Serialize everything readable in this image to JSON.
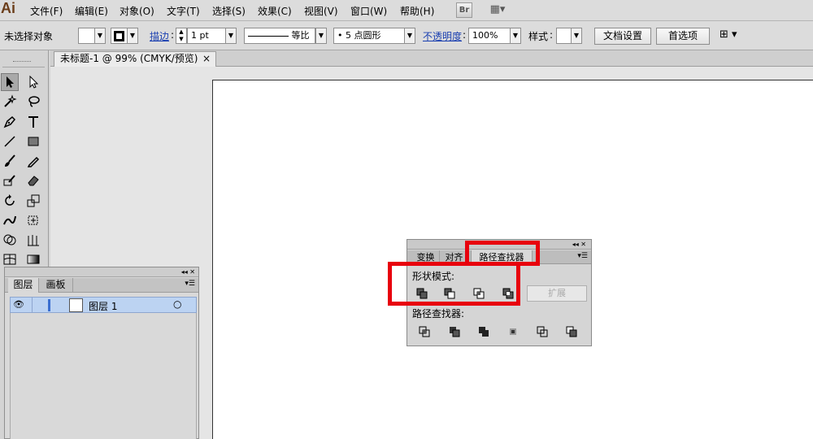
{
  "app": {
    "logo": "Ai"
  },
  "menu": [
    "文件(F)",
    "编辑(E)",
    "对象(O)",
    "文字(T)",
    "选择(S)",
    "效果(C)",
    "视图(V)",
    "窗口(W)",
    "帮助(H)"
  ],
  "menu_buttons": {
    "bridge": "Br",
    "arrange": "▦▾"
  },
  "controlbar": {
    "selection_status": "未选择对象",
    "stroke_label": "描边",
    "stroke_weight": "1 pt",
    "stroke_profile": "等比",
    "brush": "5 点圆形",
    "opacity_label": "不透明度",
    "opacity_value": "100%",
    "style_label": "样式",
    "doc_setup_button": "文档设置",
    "preferences_button": "首选项"
  },
  "document_tab": {
    "title": "未标题-1 @ 99% (CMYK/预览)",
    "close": "×"
  },
  "layers_panel": {
    "collapse": "◂◂ ✕",
    "tabs": [
      "图层",
      "画板"
    ],
    "menu": "▾☰",
    "layer_name": "图层 1",
    "eye": "👁",
    "target": "○"
  },
  "pathfinder_panel": {
    "collapse": "◂◂  ✕",
    "tabs": [
      "变换",
      "对齐",
      "路径查找器"
    ],
    "menu": "▾☰",
    "shape_modes_label": "形状模式:",
    "expand_button": "扩展",
    "pathfinders_label": "路径查找器:"
  },
  "colors": {
    "highlight": "#e8000d",
    "selected_layer": "#bcd3f2",
    "link": "#1a3fb0"
  }
}
